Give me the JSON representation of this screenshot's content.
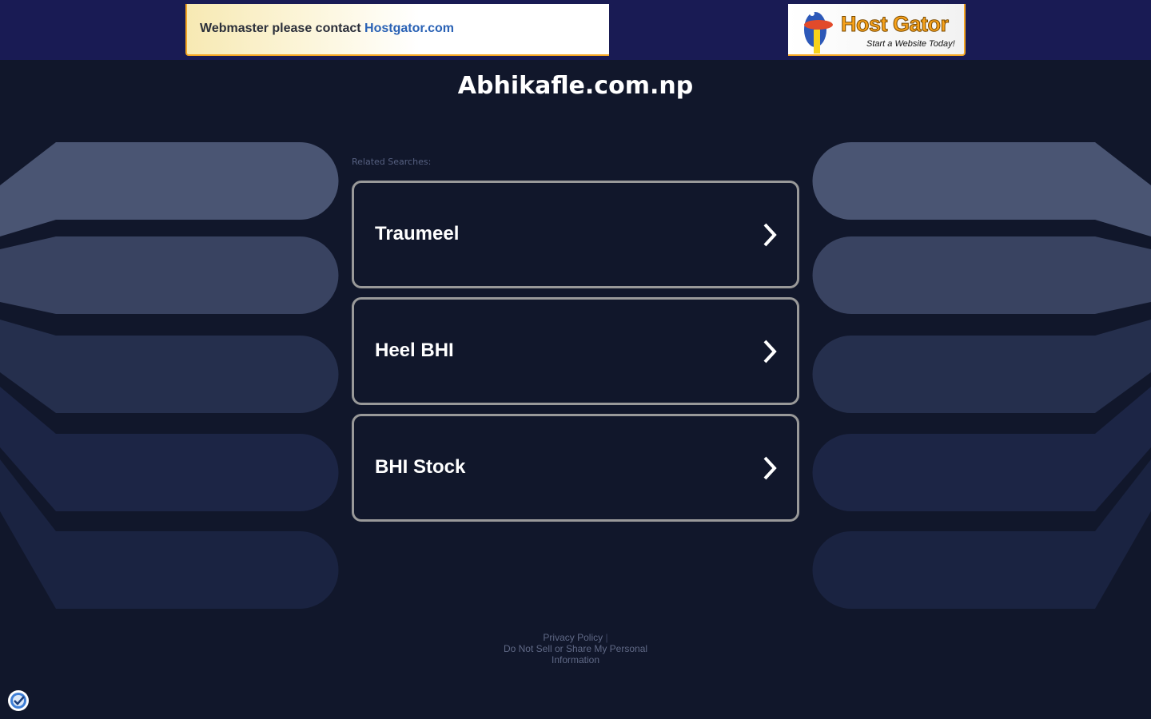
{
  "top_banner": {
    "message": "Webmaster please contact ",
    "link_text": "Hostgator.com",
    "ad_brand": "Host Gator",
    "ad_tagline": "Start a Website Today!"
  },
  "site_title": "Abhikafle.com.np",
  "related_label": "Related Searches:",
  "related_searches": [
    {
      "label": "Traumeel"
    },
    {
      "label": "Heel BHI"
    },
    {
      "label": "BHI Stock"
    }
  ],
  "footer": {
    "privacy_policy": "Privacy Policy",
    "separator": "|",
    "do_not_sell": "Do Not Sell or Share My Personal Information"
  },
  "colors": {
    "background": "#11172b",
    "topbar": "#191b54",
    "link": "#2a62b5",
    "card_border": "#999999"
  }
}
